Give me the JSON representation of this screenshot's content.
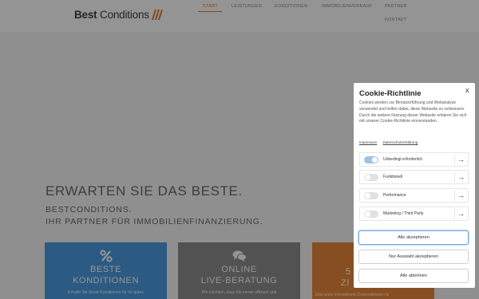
{
  "header": {
    "logo_text_bold": "Best",
    "logo_text": " Conditions",
    "nav": [
      "START",
      "LEISTUNGEN",
      "KONDITIONEN",
      "IMMOBILIENVERKAUF",
      "PARTNER",
      "KONTAKT"
    ]
  },
  "hero": {
    "title": "ERWARTEN SIE DAS BESTE.",
    "subtitle_line1": "BESTCONDITIONS.",
    "subtitle_line2": "IHR PARTNER FÜR IMMOBILIENFINANZIERUNG."
  },
  "tiles": [
    {
      "icon": "percent-icon",
      "line1": "BESTE",
      "line2": "KONDITIONEN",
      "text": "Erhalte Sie Beste Konditionen für Ihr gutes"
    },
    {
      "icon": "chat-icon",
      "line1": "ONLINE",
      "line2": "LIVE-BERATUNG",
      "text": "Wir möchten, dass Sie immer effizient und"
    },
    {
      "icon": "",
      "line1": "5",
      "line2": "ZI",
      "text": "Eine erste Immobilienfi Zinskonditionen bi"
    }
  ],
  "cookie": {
    "title": "Cookie-Richtlinie",
    "close": "x",
    "body": "Cookies werden zur Benutzerführung und Webanalyse verwendet und helfen dabei, diese Webseite zu verbessern. Durch die weitere Nutzung dieser Webseite erklären Sie sich mit unserer Cookie-Richtlinie einverstanden.",
    "link_imprint": "Impressum",
    "link_privacy": "Datenschutzerklärung",
    "options": [
      {
        "label": "Unbedingt erforderlich",
        "enabled": true
      },
      {
        "label": "Funktionell",
        "enabled": false
      },
      {
        "label": "Performance",
        "enabled": false
      },
      {
        "label": "Marketing / Third Party",
        "enabled": false
      }
    ],
    "arrow": "→",
    "btn_accept_all": "Alle akzeptieren",
    "btn_accept_selected": "Nur Auswahl akzeptieren",
    "btn_reject_all": "Alle ablehnen"
  },
  "colors": {
    "accent_orange": "#e07a2c",
    "tile_blue": "#4a9ee0",
    "tile_gray": "#8e8e8e",
    "tile_orange": "#e8893a",
    "toggle_on": "#9fc3e2"
  }
}
